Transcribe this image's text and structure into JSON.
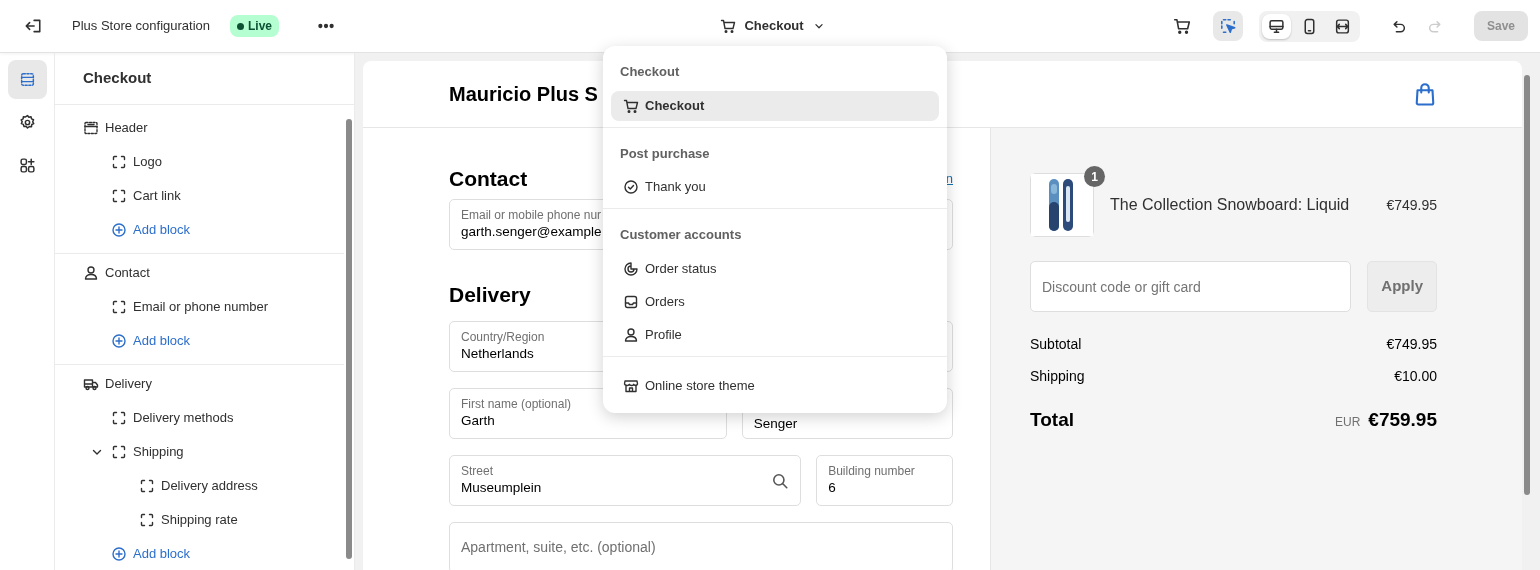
{
  "topbar": {
    "title": "Plus Store configuration",
    "status": "Live",
    "page_switcher": "Checkout",
    "tools": [
      {
        "kind": "cart",
        "selected": false
      },
      {
        "kind": "select",
        "selected": true
      }
    ],
    "devices": [
      {
        "kind": "desktop",
        "selected": true
      },
      {
        "kind": "mobile",
        "selected": false
      },
      {
        "kind": "fullwidth",
        "selected": false
      }
    ],
    "undo": {
      "disabled": false
    },
    "redo": {
      "disabled": true
    },
    "save": {
      "label": "Save",
      "disabled": true
    }
  },
  "rail": [
    {
      "kind": "sections",
      "selected": true
    },
    {
      "kind": "settings",
      "selected": false
    },
    {
      "kind": "apps",
      "selected": false
    }
  ],
  "sidebar": {
    "title": "Checkout",
    "sections": [
      {
        "kind": "header",
        "label": "Header",
        "children": [
          {
            "kind": "block",
            "label": "Logo"
          },
          {
            "kind": "block",
            "label": "Cart link"
          },
          {
            "kind": "add",
            "label": "Add block"
          }
        ]
      },
      {
        "kind": "contact",
        "label": "Contact",
        "children": [
          {
            "kind": "block",
            "label": "Email or phone number"
          },
          {
            "kind": "add",
            "label": "Add block"
          }
        ]
      },
      {
        "kind": "delivery",
        "label": "Delivery",
        "children": [
          {
            "kind": "block",
            "label": "Delivery methods"
          },
          {
            "kind": "block",
            "label": "Shipping",
            "expanded": true,
            "children": [
              {
                "kind": "block",
                "label": "Delivery address"
              },
              {
                "kind": "block",
                "label": "Shipping rate"
              }
            ]
          },
          {
            "kind": "add",
            "label": "Add block"
          }
        ]
      }
    ]
  },
  "preview": {
    "store_name": "Mauricio Plus S",
    "contact": {
      "heading": "Contact",
      "link": "n",
      "field": {
        "label": "Email or mobile phone nur",
        "value": "garth.senger@example"
      }
    },
    "delivery": {
      "heading": "Delivery",
      "rows": [
        [
          {
            "label": "Country/Region",
            "value": "Netherlands"
          }
        ],
        [
          {
            "label": "First name (optional)",
            "value": "Garth"
          },
          {
            "value": "Senger"
          }
        ],
        [
          {
            "label": "Street",
            "value": "Museumplein",
            "search": true
          },
          {
            "label": "Building number",
            "value": "6"
          }
        ],
        [
          {
            "placeholder": "Apartment, suite, etc. (optional)"
          }
        ]
      ]
    },
    "summary": {
      "item": {
        "quantity": "1",
        "name": "The Collection Snowboard: Liquid",
        "price": "€749.95"
      },
      "discount": {
        "placeholder": "Discount code or gift card",
        "button": "Apply",
        "disabled": true
      },
      "lines": [
        {
          "label": "Subtotal",
          "value": "€749.95"
        },
        {
          "label": "Shipping",
          "value": "€10.00"
        }
      ],
      "total": {
        "label": "Total",
        "currency": "EUR",
        "value": "€759.95"
      }
    }
  },
  "menu": {
    "groups": [
      {
        "heading": "Checkout",
        "items": [
          {
            "kind": "cart",
            "label": "Checkout",
            "selected": true
          }
        ]
      },
      {
        "heading": "Post purchase",
        "items": [
          {
            "kind": "check",
            "label": "Thank you",
            "selected": false
          }
        ]
      },
      {
        "heading": "Customer accounts",
        "items": [
          {
            "kind": "status",
            "label": "Order status",
            "selected": false
          },
          {
            "kind": "inbox",
            "label": "Orders",
            "selected": false
          },
          {
            "kind": "person",
            "label": "Profile",
            "selected": false
          }
        ]
      },
      {
        "items": [
          {
            "kind": "store",
            "label": "Online store theme",
            "selected": false
          }
        ]
      }
    ]
  }
}
